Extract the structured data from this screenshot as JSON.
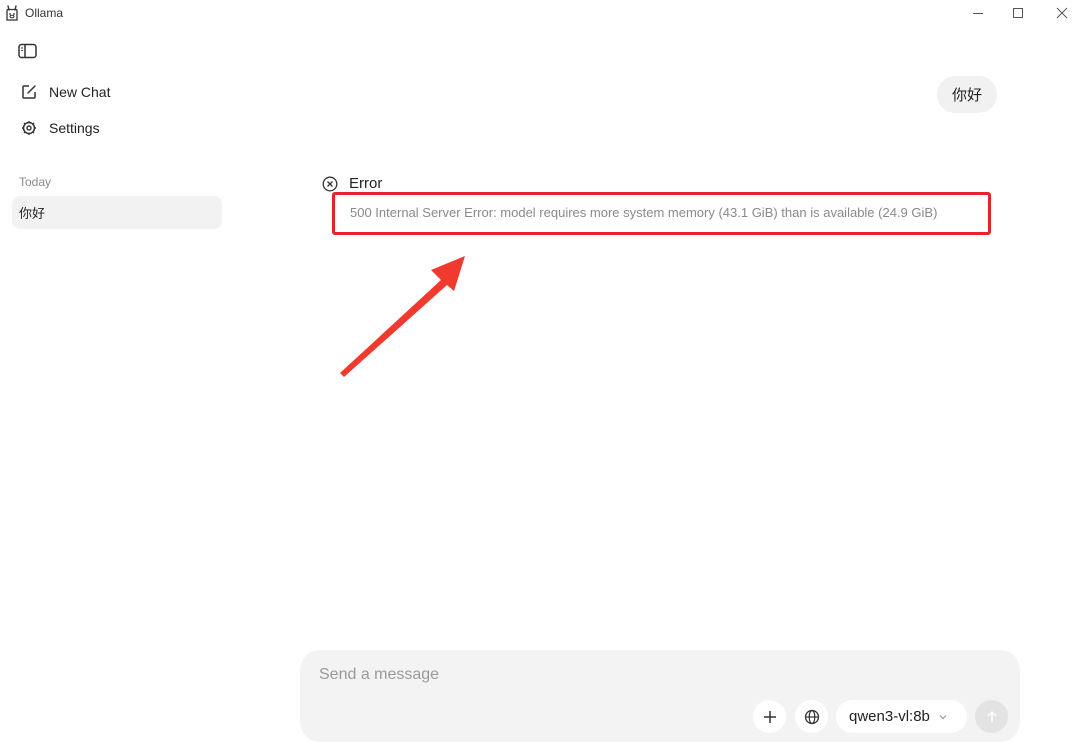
{
  "window": {
    "title": "Ollama"
  },
  "sidebar": {
    "items": [
      {
        "label": "New Chat",
        "icon": "compose-icon"
      },
      {
        "label": "Settings",
        "icon": "gear-icon"
      }
    ],
    "section_label": "Today",
    "history": [
      {
        "label": "你好"
      }
    ]
  },
  "chat": {
    "user_message": "你好",
    "error": {
      "title": "Error",
      "message": "500 Internal Server Error: model requires more system memory (43.1 GiB) than is available (24.9 GiB)"
    }
  },
  "composer": {
    "placeholder": "Send a message",
    "model": "qwen3-vl:8b"
  },
  "colors": {
    "highlight": "#e8222b",
    "bubble": "#f1f1f1",
    "composer_bg": "#f3f3f3"
  }
}
